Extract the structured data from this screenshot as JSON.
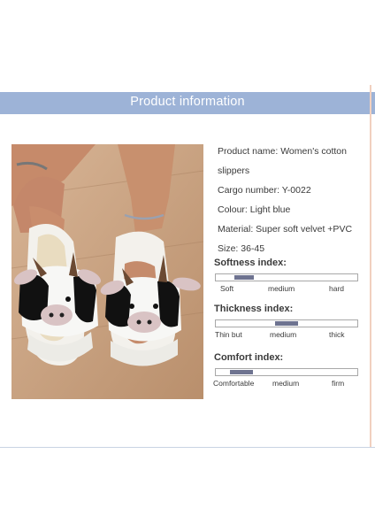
{
  "banner": {
    "title": "Product information"
  },
  "product": {
    "name_line_1": "Product name: Women's cotton",
    "name_line_2": "slippers",
    "cargo_number": "Cargo number: Y-0022",
    "colour": "Colour: Light blue",
    "material": "Material: Super soft velvet +PVC",
    "size": "Size: 36-45"
  },
  "indices": [
    {
      "title": "Softness index:",
      "level_percent": 20,
      "labels": [
        "Soft",
        "medium",
        "hard"
      ]
    },
    {
      "title": "Thickness index:",
      "level_percent": 50,
      "labels": [
        "Thin but",
        "medium",
        "thick"
      ]
    },
    {
      "title": "Comfort index:",
      "level_percent": 18,
      "labels": [
        "Comfortable",
        "medium",
        "firm"
      ]
    }
  ],
  "colors": {
    "banner": "#9db3d7",
    "bar_fill": "#6e7390",
    "accent_line": "#f1d0bf"
  }
}
